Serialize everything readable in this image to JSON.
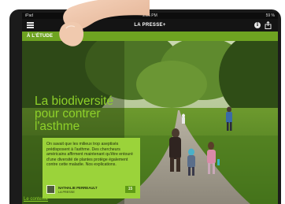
{
  "status_bar": {
    "carrier": "iPad",
    "time": "2:26 PM",
    "battery": "59 %"
  },
  "header": {
    "title": "LA PRESSE+"
  },
  "section": {
    "label": "À L'ÉTUDE"
  },
  "article": {
    "headline": "La biodiversité pour contrer l'asthme",
    "summary": "On savait que les milieux trop aseptisés prédisposent à l'asthme. Des chercheurs américains affirment maintenant qu'être entouré d'une diversité de plantes protège également contre cette maladie. Nos explications.",
    "author_name": "NATHALIE PERREAULT",
    "author_outlet": "LA PRESSE",
    "count_badge": "15",
    "context_link": "Le contexte"
  },
  "colors": {
    "accent_green": "#6ea321",
    "headline_green": "#8fd12a",
    "box_green": "#9bd33a"
  },
  "icons": {
    "menu": "menu-icon",
    "info": "info-icon",
    "share": "share-icon"
  }
}
